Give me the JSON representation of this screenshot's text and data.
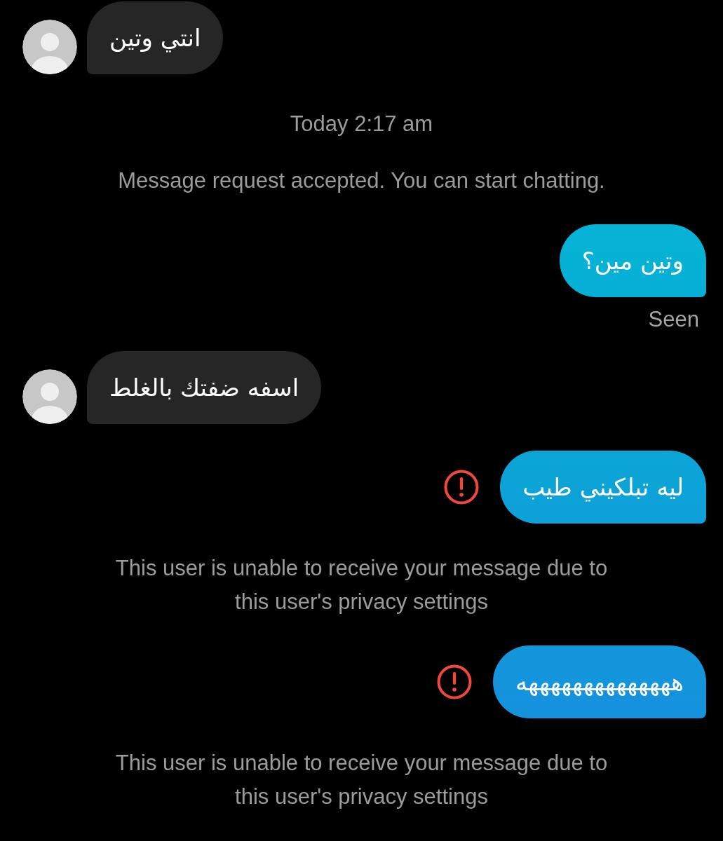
{
  "messages": [
    {
      "kind": "received",
      "text": "انتي وتين"
    },
    {
      "kind": "timestamp",
      "text": "Today 2:17 am"
    },
    {
      "kind": "notice",
      "text": "Message request accepted. You can start chatting."
    },
    {
      "kind": "sent",
      "text": "وتين مين؟",
      "failed": false,
      "receipt": "Seen"
    },
    {
      "kind": "received",
      "text": "اسفه ضفتك بالغلط"
    },
    {
      "kind": "sent",
      "text": "ليه تبلكيني طيب",
      "failed": true
    },
    {
      "kind": "notice",
      "text": "This user is unable to receive your message due to this user's privacy settings"
    },
    {
      "kind": "sent",
      "text": "ههههههههههههههه",
      "failed": true
    },
    {
      "kind": "notice",
      "text": "This user is unable to receive your message due to this user's privacy settings"
    }
  ]
}
